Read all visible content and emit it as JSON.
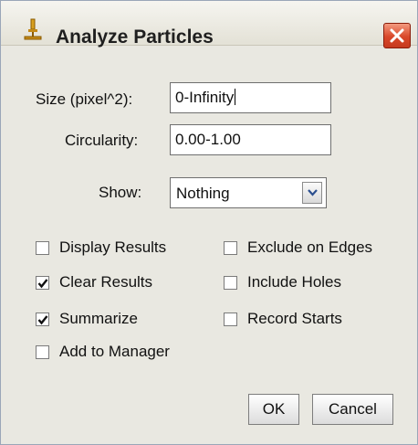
{
  "window": {
    "title": "Analyze Particles"
  },
  "fields": {
    "size": {
      "label": "Size (pixel^2):",
      "value": "0-Infinity"
    },
    "circularity": {
      "label": "Circularity:",
      "value": "0.00-1.00"
    }
  },
  "show": {
    "label": "Show:",
    "selected": "Nothing"
  },
  "options": {
    "display_results": {
      "label": "Display Results",
      "checked": false
    },
    "exclude_on_edges": {
      "label": "Exclude on Edges",
      "checked": false
    },
    "clear_results": {
      "label": "Clear Results",
      "checked": true
    },
    "include_holes": {
      "label": "Include Holes",
      "checked": false
    },
    "summarize": {
      "label": "Summarize",
      "checked": true
    },
    "record_starts": {
      "label": "Record Starts",
      "checked": false
    },
    "add_to_manager": {
      "label": "Add to Manager",
      "checked": false
    }
  },
  "buttons": {
    "ok": "OK",
    "cancel": "Cancel"
  },
  "icons": {
    "title_icon": "microscope-icon",
    "close": "close-icon",
    "dropdown": "chevron-down-icon",
    "check": "checkmark-icon"
  },
  "colors": {
    "close_button": "#d9482a",
    "window_bg": "#e9e8e1"
  }
}
